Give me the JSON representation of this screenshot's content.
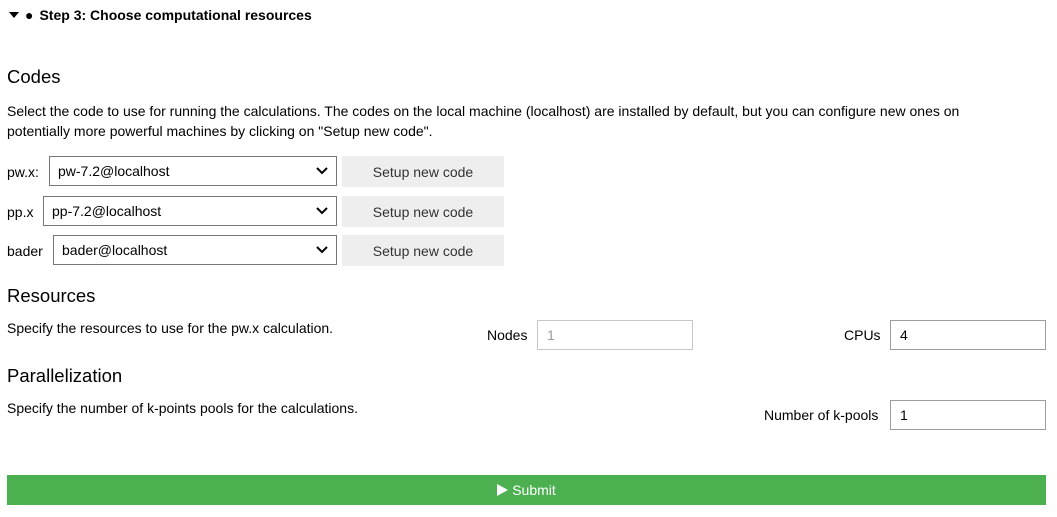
{
  "step": {
    "bullet": "●",
    "title": "Step 3: Choose computational resources"
  },
  "codes": {
    "heading": "Codes",
    "description_line1": "Select the code to use for running the calculations. The codes on the local machine (localhost) are installed by default, but you can configure new ones on",
    "description_line2": "potentially more powerful machines by clicking on \"Setup new code\".",
    "rows": [
      {
        "label": "pw.x:",
        "selected": "pw-7.2@localhost",
        "button": "Setup new code"
      },
      {
        "label": "pp.x",
        "selected": "pp-7.2@localhost",
        "button": "Setup new code"
      },
      {
        "label": "bader",
        "selected": "bader@localhost",
        "button": "Setup new code"
      }
    ]
  },
  "resources": {
    "heading": "Resources",
    "description": "Specify the resources to use for the pw.x calculation.",
    "nodes_label": "Nodes",
    "nodes_value": "1",
    "cpus_label": "CPUs",
    "cpus_value": "4"
  },
  "parallelization": {
    "heading": "Parallelization",
    "description": "Specify the number of k-points pools for the calculations.",
    "kpools_label": "Number of k-pools",
    "kpools_value": "1"
  },
  "submit": {
    "label": "Submit",
    "color": "#4caf50"
  }
}
